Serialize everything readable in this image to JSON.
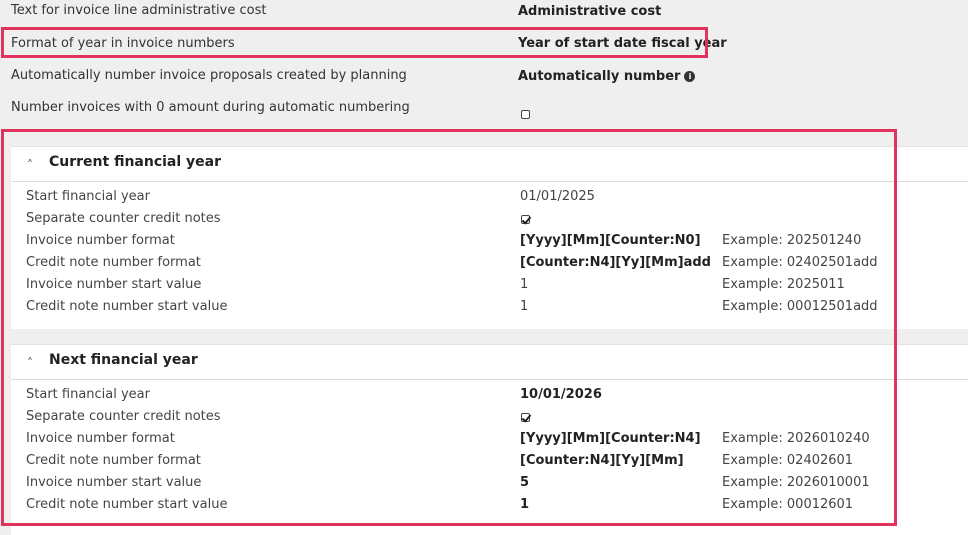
{
  "settings": [
    {
      "label": "Text for invoice line administrative cost",
      "value": "Administrative cost"
    },
    {
      "label": "Format of year in invoice numbers",
      "value": "Year of start date fiscal year"
    },
    {
      "label": "Automatically number invoice proposals created by planning",
      "value": "Automatically number"
    },
    {
      "label": "Number invoices with 0 amount during automatic numbering",
      "checked": false
    }
  ],
  "current": {
    "title": "Current financial year",
    "rows": [
      {
        "label": "Start financial year",
        "value": "01/01/2025",
        "example": ""
      },
      {
        "label": "Separate counter credit notes",
        "checked": true
      },
      {
        "label": "Invoice number format",
        "value": "[Yyyy][Mm][Counter:N0]",
        "example": "Example: 202501240"
      },
      {
        "label": "Credit note number format",
        "value": "[Counter:N4][Yy][Mm]add",
        "example": "Example: 02402501add"
      },
      {
        "label": "Invoice number start value",
        "value": "1",
        "example": "Example: 2025011"
      },
      {
        "label": "Credit note number start value",
        "value": "1",
        "example": "Example: 00012501add"
      }
    ]
  },
  "next": {
    "title": "Next financial year",
    "rows": [
      {
        "label": "Start financial year",
        "value": "10/01/2026",
        "example": ""
      },
      {
        "label": "Separate counter credit notes",
        "checked": true
      },
      {
        "label": "Invoice number format",
        "value": "[Yyyy][Mm][Counter:N4]",
        "example": "Example: 2026010240"
      },
      {
        "label": "Credit note number format",
        "value": "[Counter:N4][Yy][Mm]",
        "example": "Example: 02402601"
      },
      {
        "label": "Invoice number start value",
        "value": "5",
        "example": "Example: 2026010001"
      },
      {
        "label": "Credit note number start value",
        "value": "1",
        "example": "Example: 00012601"
      }
    ]
  },
  "colors": {
    "highlight": "#e0345f",
    "panel_bg": "#ffffff",
    "page_bg": "#efefef"
  },
  "icons": {
    "info": "info-icon",
    "collapse": "chevron-up-icon"
  }
}
